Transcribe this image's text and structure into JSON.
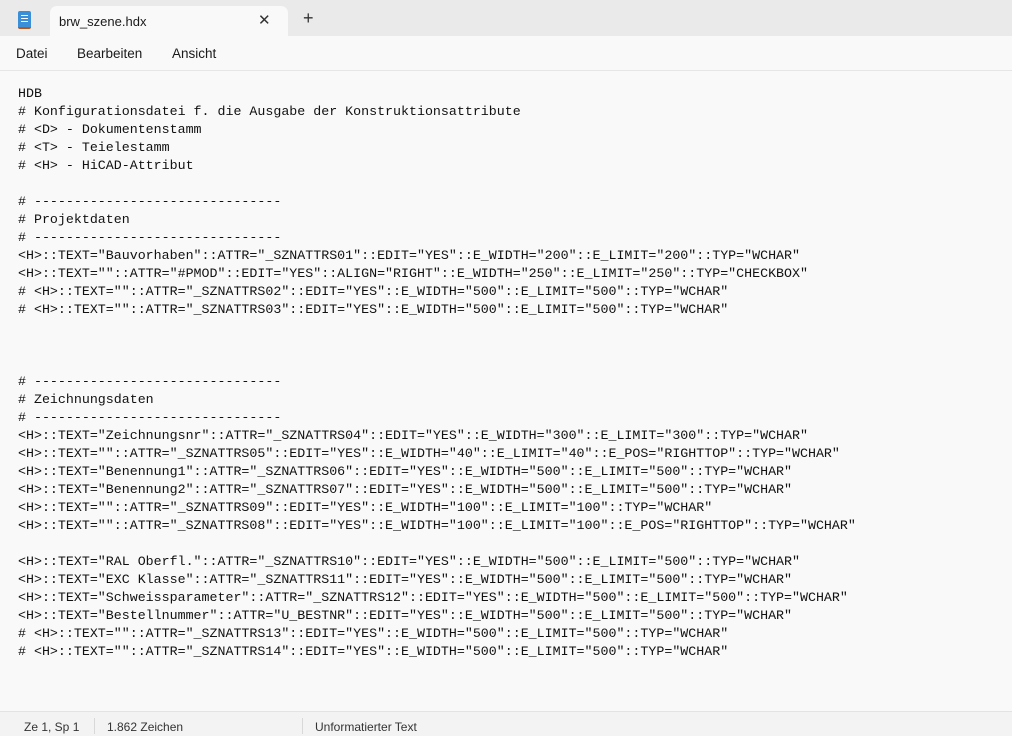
{
  "tab": {
    "title": "brw_szene.hdx",
    "close_icon": "close-icon",
    "new_tab_icon": "plus-icon"
  },
  "menu": {
    "items": [
      "Datei",
      "Bearbeiten",
      "Ansicht"
    ]
  },
  "editor": {
    "lines": [
      "HDB",
      "# Konfigurationsdatei f. die Ausgabe der Konstruktionsattribute",
      "# <D> - Dokumentenstamm",
      "# <T> - Teielestamm",
      "# <H> - HiCAD-Attribut",
      "",
      "# -------------------------------",
      "# Projektdaten",
      "# -------------------------------",
      "<H>::TEXT=\"Bauvorhaben\"::ATTR=\"_SZNATTRS01\"::EDIT=\"YES\"::E_WIDTH=\"200\"::E_LIMIT=\"200\"::TYP=\"WCHAR\"",
      "<H>::TEXT=\"\"::ATTR=\"#PMOD\"::EDIT=\"YES\"::ALIGN=\"RIGHT\"::E_WIDTH=\"250\"::E_LIMIT=\"250\"::TYP=\"CHECKBOX\"",
      "# <H>::TEXT=\"\"::ATTR=\"_SZNATTRS02\"::EDIT=\"YES\"::E_WIDTH=\"500\"::E_LIMIT=\"500\"::TYP=\"WCHAR\"",
      "# <H>::TEXT=\"\"::ATTR=\"_SZNATTRS03\"::EDIT=\"YES\"::E_WIDTH=\"500\"::E_LIMIT=\"500\"::TYP=\"WCHAR\"",
      "",
      "",
      "",
      "# -------------------------------",
      "# Zeichnungsdaten",
      "# -------------------------------",
      "<H>::TEXT=\"Zeichnungsnr\"::ATTR=\"_SZNATTRS04\"::EDIT=\"YES\"::E_WIDTH=\"300\"::E_LIMIT=\"300\"::TYP=\"WCHAR\"",
      "<H>::TEXT=\"\"::ATTR=\"_SZNATTRS05\"::EDIT=\"YES\"::E_WIDTH=\"40\"::E_LIMIT=\"40\"::E_POS=\"RIGHTTOP\"::TYP=\"WCHAR\"",
      "<H>::TEXT=\"Benennung1\"::ATTR=\"_SZNATTRS06\"::EDIT=\"YES\"::E_WIDTH=\"500\"::E_LIMIT=\"500\"::TYP=\"WCHAR\"",
      "<H>::TEXT=\"Benennung2\"::ATTR=\"_SZNATTRS07\"::EDIT=\"YES\"::E_WIDTH=\"500\"::E_LIMIT=\"500\"::TYP=\"WCHAR\"",
      "<H>::TEXT=\"\"::ATTR=\"_SZNATTRS09\"::EDIT=\"YES\"::E_WIDTH=\"100\"::E_LIMIT=\"100\"::TYP=\"WCHAR\"",
      "<H>::TEXT=\"\"::ATTR=\"_SZNATTRS08\"::EDIT=\"YES\"::E_WIDTH=\"100\"::E_LIMIT=\"100\"::E_POS=\"RIGHTTOP\"::TYP=\"WCHAR\"",
      "",
      "<H>::TEXT=\"RAL Oberfl.\"::ATTR=\"_SZNATTRS10\"::EDIT=\"YES\"::E_WIDTH=\"500\"::E_LIMIT=\"500\"::TYP=\"WCHAR\"",
      "<H>::TEXT=\"EXC Klasse\"::ATTR=\"_SZNATTRS11\"::EDIT=\"YES\"::E_WIDTH=\"500\"::E_LIMIT=\"500\"::TYP=\"WCHAR\"",
      "<H>::TEXT=\"Schweissparameter\"::ATTR=\"_SZNATTRS12\"::EDIT=\"YES\"::E_WIDTH=\"500\"::E_LIMIT=\"500\"::TYP=\"WCHAR\"",
      "<H>::TEXT=\"Bestellnummer\"::ATTR=\"U_BESTNR\"::EDIT=\"YES\"::E_WIDTH=\"500\"::E_LIMIT=\"500\"::TYP=\"WCHAR\"",
      "# <H>::TEXT=\"\"::ATTR=\"_SZNATTRS13\"::EDIT=\"YES\"::E_WIDTH=\"500\"::E_LIMIT=\"500\"::TYP=\"WCHAR\"",
      "# <H>::TEXT=\"\"::ATTR=\"_SZNATTRS14\"::EDIT=\"YES\"::E_WIDTH=\"500\"::E_LIMIT=\"500\"::TYP=\"WCHAR\""
    ]
  },
  "status": {
    "position": "Ze 1, Sp 1",
    "chars": "1.862 Zeichen",
    "format": "Unformatierter Text"
  }
}
